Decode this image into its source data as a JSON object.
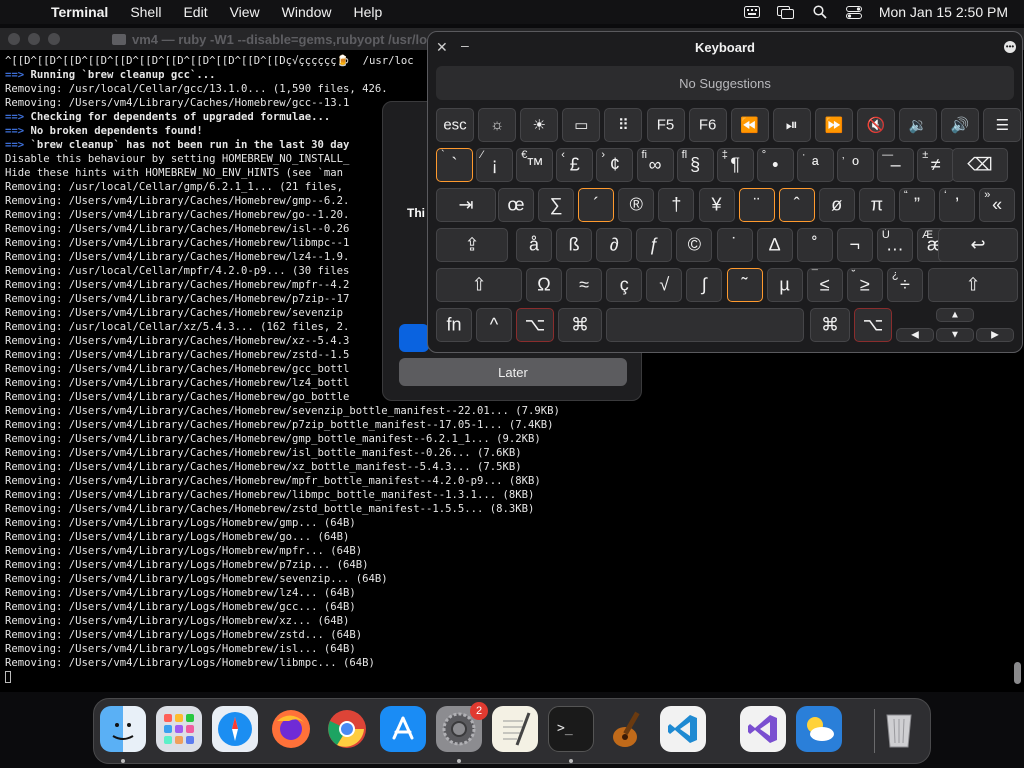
{
  "menubar": {
    "app_name": "Terminal",
    "menus": [
      "Shell",
      "Edit",
      "View",
      "Window",
      "Help"
    ],
    "clock": "Mon Jan 15  2:50 PM",
    "status_icons": [
      "keyboard-viewer-icon",
      "screen-mirroring-icon",
      "spotlight-search-icon",
      "control-center-icon"
    ]
  },
  "terminal": {
    "title": "vm4 — ruby -W1 --disable=gems,rubyopt /usr/loc",
    "lines": [
      {
        "type": "plain",
        "text": "^[[D^[[D^[[D^[[D^[[D^[[D^[[D^[[D^[[D^[[D^[[Dç√çççççç🍺  /usr/loc"
      },
      {
        "type": "arrow",
        "text": "Running `brew cleanup gcc`..."
      },
      {
        "type": "plain",
        "text": "Removing: /usr/local/Cellar/gcc/13.1.0... (1,590 files, 426."
      },
      {
        "type": "plain",
        "text": "Removing: /Users/vm4/Library/Caches/Homebrew/gcc--13.1"
      },
      {
        "type": "arrow",
        "text": "Checking for dependents of upgraded formulae..."
      },
      {
        "type": "arrow",
        "text": "No broken dependents found!"
      },
      {
        "type": "arrow",
        "text": "`brew cleanup` has not been run in the last 30 day"
      },
      {
        "type": "plain",
        "text": "Disable this behaviour by setting HOMEBREW_NO_INSTALL_"
      },
      {
        "type": "plain",
        "text": "Hide these hints with HOMEBREW_NO_ENV_HINTS (see `man"
      },
      {
        "type": "plain",
        "text": "Removing: /usr/local/Cellar/gmp/6.2.1_1... (21 files,"
      },
      {
        "type": "plain",
        "text": "Removing: /Users/vm4/Library/Caches/Homebrew/gmp--6.2."
      },
      {
        "type": "plain",
        "text": "Removing: /Users/vm4/Library/Caches/Homebrew/go--1.20."
      },
      {
        "type": "plain",
        "text": "Removing: /Users/vm4/Library/Caches/Homebrew/isl--0.26"
      },
      {
        "type": "plain",
        "text": "Removing: /Users/vm4/Library/Caches/Homebrew/libmpc--1"
      },
      {
        "type": "plain",
        "text": "Removing: /Users/vm4/Library/Caches/Homebrew/lz4--1.9."
      },
      {
        "type": "plain",
        "text": "Removing: /usr/local/Cellar/mpfr/4.2.0-p9... (30 files"
      },
      {
        "type": "plain",
        "text": "Removing: /Users/vm4/Library/Caches/Homebrew/mpfr--4.2"
      },
      {
        "type": "plain",
        "text": "Removing: /Users/vm4/Library/Caches/Homebrew/p7zip--17"
      },
      {
        "type": "plain",
        "text": "Removing: /Users/vm4/Library/Caches/Homebrew/sevenzip"
      },
      {
        "type": "plain",
        "text": "Removing: /usr/local/Cellar/xz/5.4.3... (162 files, 2."
      },
      {
        "type": "plain",
        "text": "Removing: /Users/vm4/Library/Caches/Homebrew/xz--5.4.3"
      },
      {
        "type": "plain",
        "text": "Removing: /Users/vm4/Library/Caches/Homebrew/zstd--1.5"
      },
      {
        "type": "plain",
        "text": "Removing: /Users/vm4/Library/Caches/Homebrew/gcc_bottl"
      },
      {
        "type": "plain",
        "text": "Removing: /Users/vm4/Library/Caches/Homebrew/lz4_bottl"
      },
      {
        "type": "plain",
        "text": "Removing: /Users/vm4/Library/Caches/Homebrew/go_bottle"
      },
      {
        "type": "plain",
        "text": "Removing: /Users/vm4/Library/Caches/Homebrew/sevenzip_bottle_manifest--22.01... (7.9KB)"
      },
      {
        "type": "plain",
        "text": "Removing: /Users/vm4/Library/Caches/Homebrew/p7zip_bottle_manifest--17.05-1... (7.4KB)"
      },
      {
        "type": "plain",
        "text": "Removing: /Users/vm4/Library/Caches/Homebrew/gmp_bottle_manifest--6.2.1_1... (9.2KB)"
      },
      {
        "type": "plain",
        "text": "Removing: /Users/vm4/Library/Caches/Homebrew/isl_bottle_manifest--0.26... (7.6KB)"
      },
      {
        "type": "plain",
        "text": "Removing: /Users/vm4/Library/Caches/Homebrew/xz_bottle_manifest--5.4.3... (7.5KB)"
      },
      {
        "type": "plain",
        "text": "Removing: /Users/vm4/Library/Caches/Homebrew/mpfr_bottle_manifest--4.2.0-p9... (8KB)"
      },
      {
        "type": "plain",
        "text": "Removing: /Users/vm4/Library/Caches/Homebrew/libmpc_bottle_manifest--1.3.1... (8KB)"
      },
      {
        "type": "plain",
        "text": "Removing: /Users/vm4/Library/Caches/Homebrew/zstd_bottle_manifest--1.5.5... (8.3KB)"
      },
      {
        "type": "plain",
        "text": "Removing: /Users/vm4/Library/Logs/Homebrew/gmp... (64B)"
      },
      {
        "type": "plain",
        "text": "Removing: /Users/vm4/Library/Logs/Homebrew/go... (64B)"
      },
      {
        "type": "plain",
        "text": "Removing: /Users/vm4/Library/Logs/Homebrew/mpfr... (64B)"
      },
      {
        "type": "plain",
        "text": "Removing: /Users/vm4/Library/Logs/Homebrew/p7zip... (64B)"
      },
      {
        "type": "plain",
        "text": "Removing: /Users/vm4/Library/Logs/Homebrew/sevenzip... (64B)"
      },
      {
        "type": "plain",
        "text": "Removing: /Users/vm4/Library/Logs/Homebrew/lz4... (64B)"
      },
      {
        "type": "plain",
        "text": "Removing: /Users/vm4/Library/Logs/Homebrew/gcc... (64B)"
      },
      {
        "type": "plain",
        "text": "Removing: /Users/vm4/Library/Logs/Homebrew/xz... (64B)"
      },
      {
        "type": "plain",
        "text": "Removing: /Users/vm4/Library/Logs/Homebrew/zstd... (64B)"
      },
      {
        "type": "plain",
        "text": "Removing: /Users/vm4/Library/Logs/Homebrew/isl... (64B)"
      },
      {
        "type": "plain",
        "text": "Removing: /Users/vm4/Library/Logs/Homebrew/libmpc... (64B)"
      }
    ]
  },
  "dialog": {
    "partial_text": "Thi",
    "later_label": "Later"
  },
  "keyboard": {
    "title": "Keyboard",
    "suggestions": "No Suggestions",
    "function_row": [
      {
        "label": "esc",
        "name": "key-esc"
      },
      {
        "label": "☼",
        "name": "key-brightness-down"
      },
      {
        "label": "☀",
        "name": "key-brightness-up"
      },
      {
        "label": "▭",
        "name": "key-mission-control"
      },
      {
        "label": "⠿",
        "name": "key-launchpad"
      },
      {
        "label": "F5",
        "name": "key-f5"
      },
      {
        "label": "F6",
        "name": "key-f6"
      },
      {
        "label": "⏪",
        "name": "key-rewind"
      },
      {
        "label": "⏯",
        "name": "key-play-pause"
      },
      {
        "label": "⏩",
        "name": "key-fast-forward"
      },
      {
        "label": "🔇",
        "name": "key-mute"
      },
      {
        "label": "🔉",
        "name": "key-volume-down"
      },
      {
        "label": "🔊",
        "name": "key-volume-up"
      },
      {
        "label": "☰",
        "name": "key-menu"
      }
    ],
    "number_row": [
      {
        "main": "`",
        "alt": "`",
        "hl": true
      },
      {
        "main": "¡",
        "alt": "⁄"
      },
      {
        "main": "™",
        "alt": "€"
      },
      {
        "main": "£",
        "alt": "‹"
      },
      {
        "main": "¢",
        "alt": "›"
      },
      {
        "main": "∞",
        "alt": "ﬁ"
      },
      {
        "main": "§",
        "alt": "ﬂ"
      },
      {
        "main": "¶",
        "alt": "‡"
      },
      {
        "main": "•",
        "alt": "°"
      },
      {
        "main": "ª",
        "alt": "·"
      },
      {
        "main": "º",
        "alt": "‚"
      },
      {
        "main": "–",
        "alt": "—"
      },
      {
        "main": "≠",
        "alt": "±"
      },
      {
        "main": "⌫",
        "alt": ""
      }
    ],
    "qwerty_row": [
      {
        "main": "⇥",
        "alt": ""
      },
      {
        "main": "œ",
        "alt": ""
      },
      {
        "main": "∑",
        "alt": ""
      },
      {
        "main": "´",
        "alt": "",
        "hl": true
      },
      {
        "main": "®",
        "alt": ""
      },
      {
        "main": "†",
        "alt": ""
      },
      {
        "main": "¥",
        "alt": ""
      },
      {
        "main": "¨",
        "alt": "",
        "hl": true
      },
      {
        "main": "ˆ",
        "alt": "",
        "hl": true
      },
      {
        "main": "ø",
        "alt": ""
      },
      {
        "main": "π",
        "alt": ""
      },
      {
        "main": "”",
        "alt": "“"
      },
      {
        "main": "’",
        "alt": "‘"
      },
      {
        "main": "«",
        "alt": "»"
      }
    ],
    "home_row": [
      {
        "main": "⇪",
        "alt": ""
      },
      {
        "main": "å",
        "alt": ""
      },
      {
        "main": "ß",
        "alt": ""
      },
      {
        "main": "∂",
        "alt": ""
      },
      {
        "main": "ƒ",
        "alt": ""
      },
      {
        "main": "©",
        "alt": ""
      },
      {
        "main": "˙",
        "alt": ""
      },
      {
        "main": "∆",
        "alt": ""
      },
      {
        "main": "˚",
        "alt": ""
      },
      {
        "main": "¬",
        "alt": ""
      },
      {
        "main": "…",
        "alt": "Ú"
      },
      {
        "main": "æ",
        "alt": "Æ"
      },
      {
        "main": "↩",
        "alt": ""
      }
    ],
    "shift_row": [
      {
        "main": "⇧",
        "alt": ""
      },
      {
        "main": "Ω",
        "alt": ""
      },
      {
        "main": "≈",
        "alt": ""
      },
      {
        "main": "ç",
        "alt": ""
      },
      {
        "main": "√",
        "alt": ""
      },
      {
        "main": "∫",
        "alt": ""
      },
      {
        "main": "˜",
        "alt": "",
        "hl": true
      },
      {
        "main": "µ",
        "alt": ""
      },
      {
        "main": "≤",
        "alt": "¯"
      },
      {
        "main": "≥",
        "alt": "˘"
      },
      {
        "main": "÷",
        "alt": "¿"
      },
      {
        "main": "⇧",
        "alt": ""
      }
    ],
    "bottom_row": [
      {
        "main": "fn",
        "name": "key-fn"
      },
      {
        "main": "^",
        "name": "key-control"
      },
      {
        "main": "⌥",
        "name": "key-option-left"
      },
      {
        "main": "⌘",
        "name": "key-command-left"
      },
      {
        "main": "",
        "name": "key-space"
      },
      {
        "main": "⌘",
        "name": "key-command-right"
      },
      {
        "main": "⌥",
        "name": "key-option-right"
      }
    ],
    "arrows": {
      "up": "▲",
      "down": "▼",
      "left": "◀",
      "right": "▶"
    }
  },
  "dock": {
    "apps": [
      {
        "name": "finder-icon",
        "running": true
      },
      {
        "name": "launchpad-icon",
        "running": false
      },
      {
        "name": "safari-icon",
        "running": false
      },
      {
        "name": "firefox-icon",
        "running": false
      },
      {
        "name": "chrome-icon",
        "running": false
      },
      {
        "name": "app-store-icon",
        "running": false
      },
      {
        "name": "system-settings-icon",
        "running": true,
        "badge": "2"
      },
      {
        "name": "textedit-icon",
        "running": false
      },
      {
        "name": "terminal-icon",
        "running": true
      },
      {
        "name": "garageband-icon",
        "running": false
      },
      {
        "name": "vscode-icon",
        "running": false
      },
      {
        "name": "visual-studio-icon",
        "running": false
      },
      {
        "name": "weather-icon",
        "running": false
      },
      {
        "name": "trash-icon",
        "running": false
      }
    ]
  }
}
